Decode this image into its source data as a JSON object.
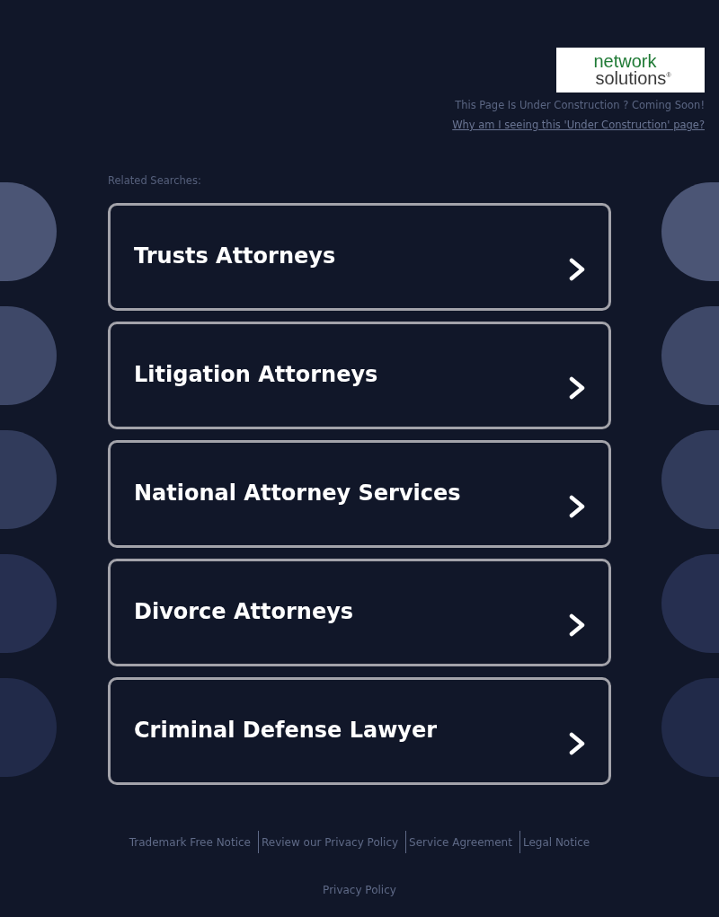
{
  "header": {
    "logo": {
      "line_1": "network",
      "line_2": "solutions$^{®}$"
    },
    "notice": "This Page Is Under Construction ? Coming Soon!",
    "help_link": "Why am I seeing this 'Under Construction' page?"
  },
  "related_searches": {
    "heading": "Related Searches:",
    "links": [
      {
        "label": "Trusts Attorneys"
      },
      {
        "label": "Litigation Attorneys"
      },
      {
        "label": "National Attorney Services"
      },
      {
        "label": "Divorce Attorneys"
      },
      {
        "label": "Criminal Defense Lawyer"
      }
    ]
  },
  "footer": {
    "links": [
      "Trademark Free Notice",
      "Review our Privacy Policy",
      "Service Agreement",
      "Legal Notice"
    ],
    "privacy_link": "Privacy Policy"
  }
}
